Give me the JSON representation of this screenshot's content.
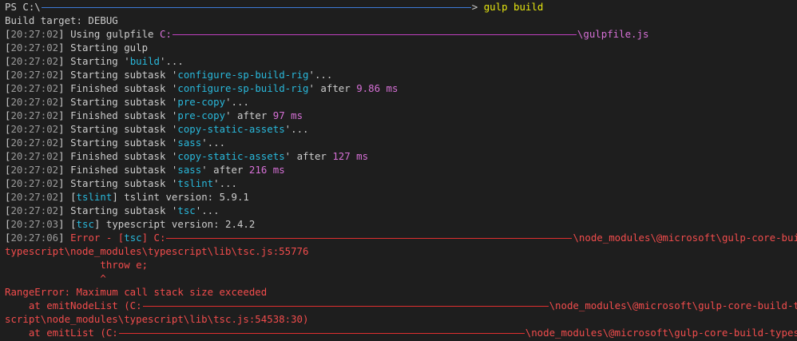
{
  "colors": {
    "background": "#1e1e1e",
    "timestamp": "#9a9a9a",
    "name": "#29b8db",
    "time": "#d670d6",
    "command": "#e5e510",
    "error": "#f14c4c"
  },
  "prompt": {
    "prefix": "PS C:\\",
    "suffix": "> ",
    "command": "gulp build"
  },
  "build_target": "Build target: DEBUG",
  "using_line": {
    "ts": "20:27:02",
    "text": " Using gulpfile ",
    "path_start": "C:",
    "path_end": "\\gulpfile.js"
  },
  "logs": [
    {
      "ts": "20:27:02",
      "pre": " Starting gulp"
    },
    {
      "ts": "20:27:02",
      "pre": " Starting '",
      "name": "build",
      "post": "'..."
    },
    {
      "ts": "20:27:02",
      "pre": " Starting subtask '",
      "name": "configure-sp-build-rig",
      "post": "'..."
    },
    {
      "ts": "20:27:02",
      "pre": " Finished subtask '",
      "name": "configure-sp-build-rig",
      "post": "' after ",
      "time": "9.86 ms"
    },
    {
      "ts": "20:27:02",
      "pre": " Starting subtask '",
      "name": "pre-copy",
      "post": "'..."
    },
    {
      "ts": "20:27:02",
      "pre": " Finished subtask '",
      "name": "pre-copy",
      "post": "' after ",
      "time": "97 ms"
    },
    {
      "ts": "20:27:02",
      "pre": " Starting subtask '",
      "name": "copy-static-assets",
      "post": "'..."
    },
    {
      "ts": "20:27:02",
      "pre": " Starting subtask '",
      "name": "sass",
      "post": "'..."
    },
    {
      "ts": "20:27:02",
      "pre": " Finished subtask '",
      "name": "copy-static-assets",
      "post": "' after ",
      "time": "127 ms"
    },
    {
      "ts": "20:27:02",
      "pre": " Finished subtask '",
      "name": "sass",
      "post": "' after ",
      "time": "216 ms"
    },
    {
      "ts": "20:27:02",
      "pre": " Starting subtask '",
      "name": "tslint",
      "post": "'..."
    },
    {
      "ts": "20:27:02",
      "pre": " [",
      "name": "tslint",
      "post": "] tslint version: 5.9.1"
    },
    {
      "ts": "20:27:02",
      "pre": " Starting subtask '",
      "name": "tsc",
      "post": "'..."
    },
    {
      "ts": "20:27:03",
      "pre": " [",
      "name": "tsc",
      "post": "] typescript version: 2.4.2"
    }
  ],
  "error_line": {
    "ts": "20:27:06",
    "pre": " Error - [",
    "name": "tsc",
    "mid": "] C:",
    "path_end": "\\node_modules\\@microsoft\\gulp-core-build-"
  },
  "error_cont": "typescript\\node_modules\\typescript\\lib\\tsc.js:55776",
  "throw_line": "                throw e;",
  "caret_line": "                ^",
  "range_error": "RangeError: Maximum call stack size exceeded",
  "stack": [
    {
      "pre": "    at emitNodeList (C:",
      "post": "\\node_modules\\@microsoft\\gulp-core-build-type"
    },
    {
      "cont": "script\\node_modules\\typescript\\lib\\tsc.js:54538:30)"
    },
    {
      "pre": "    at emitList (C:",
      "post": "\\node_modules\\@microsoft\\gulp-core-build-typescri"
    }
  ]
}
